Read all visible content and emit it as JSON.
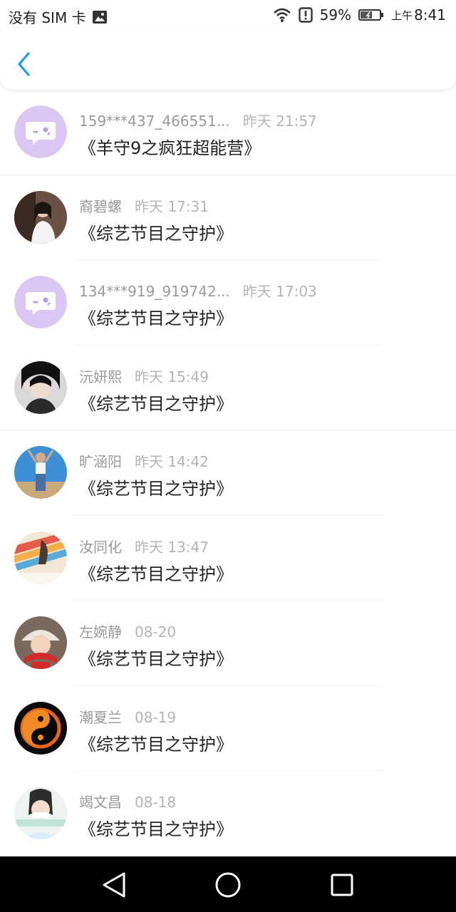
{
  "status_bar": {
    "carrier": "没有 SIM 卡",
    "battery": "59%",
    "time_prefix": "上午",
    "time": "8:41",
    "icons": [
      "image-icon",
      "wifi-icon",
      "alert-icon",
      "battery-icon"
    ]
  },
  "header": {
    "back_icon": "chevron-left-icon",
    "accent": "#2196f3"
  },
  "messages": [
    {
      "name": "159***437_466551...",
      "time": "昨天 21:57",
      "title": "《羊守9之疯狂超能营》",
      "avatar": "default"
    },
    {
      "name": "裔碧螺",
      "time": "昨天 17:31",
      "title": "《综艺节目之守护》",
      "avatar": "photo"
    },
    {
      "name": "134***919_919742...",
      "time": "昨天 17:03",
      "title": "《综艺节目之守护》",
      "avatar": "default"
    },
    {
      "name": "沅妍熙",
      "time": "昨天 15:49",
      "title": "《综艺节目之守护》",
      "avatar": "photo"
    },
    {
      "name": "旷涵阳",
      "time": "昨天 14:42",
      "title": "《综艺节目之守护》",
      "avatar": "photo"
    },
    {
      "name": "汝同化",
      "time": "昨天 13:47",
      "title": "《综艺节目之守护》",
      "avatar": "photo"
    },
    {
      "name": "左婉静",
      "time": "08-20",
      "title": "《综艺节目之守护》",
      "avatar": "photo"
    },
    {
      "name": "潮夏兰",
      "time": "08-19",
      "title": "《综艺节目之守护》",
      "avatar": "photo"
    },
    {
      "name": "竭文昌",
      "time": "08-18",
      "title": "《综艺节目之守护》",
      "avatar": "photo"
    }
  ],
  "nav_bar": {
    "buttons": [
      "back-triangle-icon",
      "home-circle-icon",
      "recents-square-icon"
    ]
  }
}
